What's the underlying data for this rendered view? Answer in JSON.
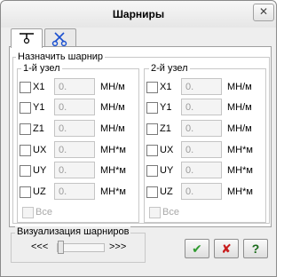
{
  "window": {
    "title": "Шарниры",
    "close_symbol": "✕"
  },
  "tabs": [
    {
      "icon": "hinge-icon",
      "active": true
    },
    {
      "icon": "scissors-icon",
      "active": false
    }
  ],
  "assign_group": {
    "label": "Назначить шарнир",
    "node1": {
      "label": "1-й узел",
      "rows": [
        {
          "label": "X1",
          "value": "0.",
          "unit": "МН/м"
        },
        {
          "label": "Y1",
          "value": "0.",
          "unit": "МН/м"
        },
        {
          "label": "Z1",
          "value": "0.",
          "unit": "МН/м"
        },
        {
          "label": "UX",
          "value": "0.",
          "unit": "МН*м"
        },
        {
          "label": "UY",
          "value": "0.",
          "unit": "МН*м"
        },
        {
          "label": "UZ",
          "value": "0.",
          "unit": "МН*м"
        }
      ],
      "all_label": "Все"
    },
    "node2": {
      "label": "2-й узел",
      "rows": [
        {
          "label": "X1",
          "value": "0.",
          "unit": "МН/м"
        },
        {
          "label": "Y1",
          "value": "0.",
          "unit": "МН/м"
        },
        {
          "label": "Z1",
          "value": "0.",
          "unit": "МН/м"
        },
        {
          "label": "UX",
          "value": "0.",
          "unit": "МН*м"
        },
        {
          "label": "UY",
          "value": "0.",
          "unit": "МН*м"
        },
        {
          "label": "UZ",
          "value": "0.",
          "unit": "МН*м"
        }
      ],
      "all_label": "Все"
    }
  },
  "visualization": {
    "label": "Визуализация шарниров",
    "left_arrows": "<<<",
    "right_arrows": ">>>",
    "slider_level": 0
  },
  "buttons": {
    "ok": "✔",
    "cancel": "✘",
    "help": "?"
  },
  "colors": {
    "ok": "#2e9a2e",
    "cancel": "#c81e1e",
    "help": "#1a6a1a"
  }
}
